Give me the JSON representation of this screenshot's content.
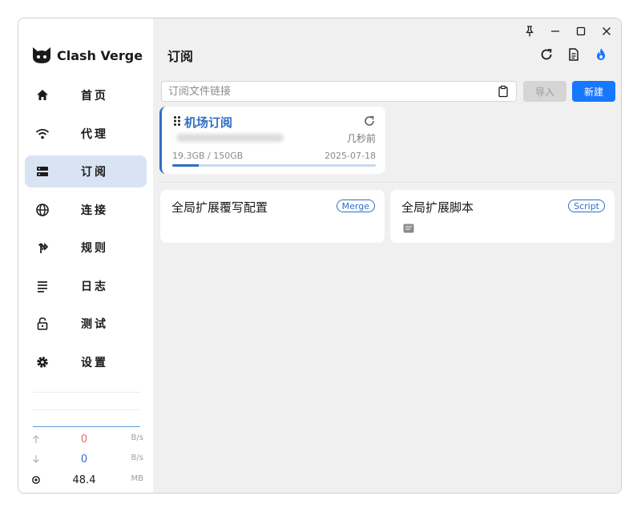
{
  "app": {
    "name": "Clash Verge"
  },
  "nav": {
    "items": [
      {
        "label": "首页",
        "icon": "home-icon",
        "active": false
      },
      {
        "label": "代理",
        "icon": "wifi-icon",
        "active": false
      },
      {
        "label": "订阅",
        "icon": "server-icon",
        "active": true
      },
      {
        "label": "连接",
        "icon": "globe-icon",
        "active": false
      },
      {
        "label": "规则",
        "icon": "fork-icon",
        "active": false
      },
      {
        "label": "日志",
        "icon": "list-icon",
        "active": false
      },
      {
        "label": "测试",
        "icon": "lock-icon",
        "active": false
      },
      {
        "label": "设置",
        "icon": "gear-icon",
        "active": false
      }
    ]
  },
  "traffic": {
    "upload": {
      "value": "0",
      "unit": "B/s",
      "color": "#e06c6c"
    },
    "download": {
      "value": "0",
      "unit": "B/s",
      "color": "#2f6fc4"
    },
    "memory": {
      "value": "48.4",
      "unit": "MB"
    }
  },
  "header": {
    "title": "订阅"
  },
  "import_bar": {
    "placeholder": "订阅文件链接",
    "value": "",
    "import_label": "导入",
    "new_label": "新建"
  },
  "subscription": {
    "name": "机场订阅",
    "updated": "几秒前",
    "usage": "19.3GB / 150GB",
    "used_fraction": 0.13,
    "expire_date": "2025-07-18"
  },
  "extensions": [
    {
      "title": "全局扩展覆写配置",
      "tag": "Merge"
    },
    {
      "title": "全局扩展脚本",
      "tag": "Script"
    }
  ],
  "colors": {
    "accent": "#1677ff",
    "brand": "#2f6fc4",
    "active_nav": "#d8e4f3"
  }
}
